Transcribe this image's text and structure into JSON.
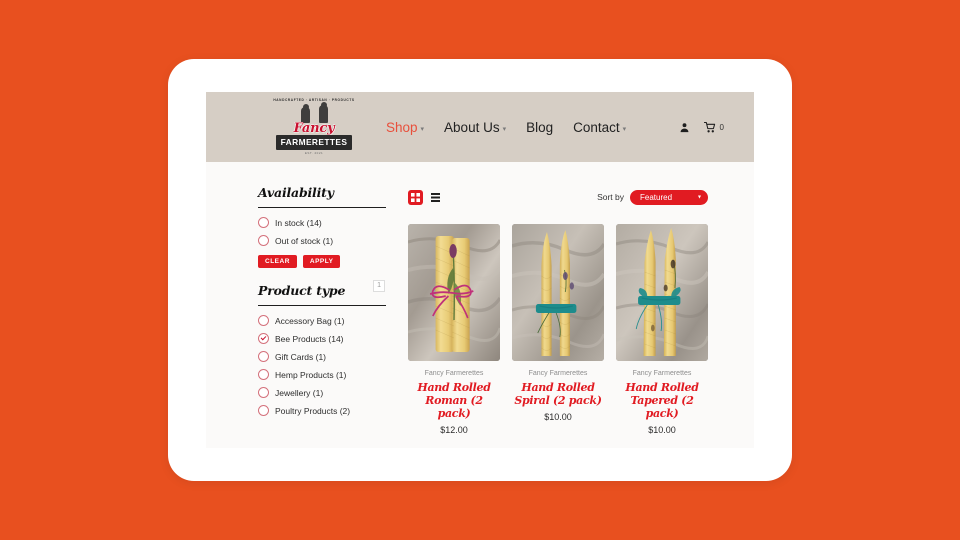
{
  "theme": {
    "page_background": "#E8501F",
    "header_background": "#D6CEC5",
    "accent_red": "#E11B22",
    "link_red": "#E8503C"
  },
  "header": {
    "logo": {
      "arc_text": "HANDCRAFTED · ARTISAN · PRODUCTS",
      "script_name": "Fancy",
      "bar_name": "FARMERETTES",
      "est_text": "EST. 2021"
    },
    "nav": [
      {
        "label": "Shop",
        "has_caret": true,
        "active": true
      },
      {
        "label": "About Us",
        "has_caret": true,
        "active": false
      },
      {
        "label": "Blog",
        "has_caret": false,
        "active": false
      },
      {
        "label": "Contact",
        "has_caret": true,
        "active": false
      }
    ],
    "actions": {
      "account_icon": "person-icon",
      "cart_icon": "cart-icon",
      "cart_count": "0"
    }
  },
  "sidebar": {
    "availability": {
      "title": "Availability",
      "options": [
        {
          "label": "In stock (14)",
          "checked": false
        },
        {
          "label": "Out of stock (1)",
          "checked": false
        }
      ],
      "clear_label": "CLEAR",
      "apply_label": "APPLY"
    },
    "product_type": {
      "title": "Product type",
      "badge": "1",
      "options": [
        {
          "label": "Accessory Bag (1)",
          "checked": false
        },
        {
          "label": "Bee Products (14)",
          "checked": true
        },
        {
          "label": "Gift Cards (1)",
          "checked": false
        },
        {
          "label": "Hemp Products (1)",
          "checked": false
        },
        {
          "label": "Jewellery (1)",
          "checked": false
        },
        {
          "label": "Poultry Products (2)",
          "checked": false
        }
      ]
    }
  },
  "toolbar": {
    "grid_view_icon": "grid-view-icon",
    "list_view_icon": "list-view-icon",
    "grid_view_active": true,
    "sort_label": "Sort by",
    "sort_value": "Featured"
  },
  "products": [
    {
      "vendor": "Fancy Farmerettes",
      "title": "Hand Rolled Roman (2 pack)",
      "price": "$12.00",
      "image": "beeswax-candle-roman-pink-ribbon"
    },
    {
      "vendor": "Fancy Farmerettes",
      "title": "Hand Rolled Spiral (2 pack)",
      "price": "$10.00",
      "image": "beeswax-candle-spiral-teal-ribbon"
    },
    {
      "vendor": "Fancy Farmerettes",
      "title": "Hand Rolled Tapered (2 pack)",
      "price": "$10.00",
      "image": "beeswax-candle-tapered-teal-ribbon"
    }
  ]
}
